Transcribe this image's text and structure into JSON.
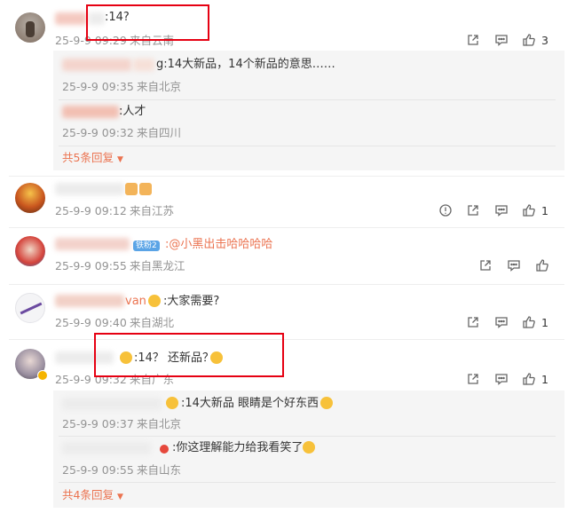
{
  "comments": [
    {
      "text": ":14?",
      "time": "25-9-9 09:29",
      "location": "来自云南",
      "likes": "3",
      "replies": [
        {
          "text": "g:14大新品，14个新品的意思……",
          "time": "25-9-9 09:35",
          "location": "来自北京"
        },
        {
          "text": ":人才",
          "time": "25-9-9 09:32",
          "location": "来自四川"
        }
      ],
      "more_replies": "共5条回复"
    },
    {
      "text": "",
      "time": "25-9-9 09:12",
      "location": "来自江苏",
      "likes": "1"
    },
    {
      "badge": "铁粉2",
      "text": ":@小黑出击哈哈哈哈",
      "time": "25-9-9 09:55",
      "location": "来自黑龙江"
    },
    {
      "name_suffix": "van",
      "text": ":大家需要?",
      "time": "25-9-9 09:40",
      "location": "来自湖北",
      "likes": "1"
    },
    {
      "text": ":14？ 还新品？",
      "time": "25-9-9 09:32",
      "location": "来自广东",
      "likes": "1",
      "replies": [
        {
          "text": ":14大新品 眼睛是个好东西",
          "time": "25-9-9 09:37",
          "location": "来自北京"
        },
        {
          "text": ":你这理解能力给我看笑了",
          "time": "25-9-9 09:55",
          "location": "来自山东"
        }
      ],
      "more_replies": "共4条回复"
    }
  ],
  "icons": {
    "share": "share-icon",
    "comment": "comment-icon",
    "like": "like-icon",
    "report": "report-icon"
  },
  "colors": {
    "link": "#eb7350",
    "meta": "#939393",
    "highlight_box": "#e60012"
  }
}
